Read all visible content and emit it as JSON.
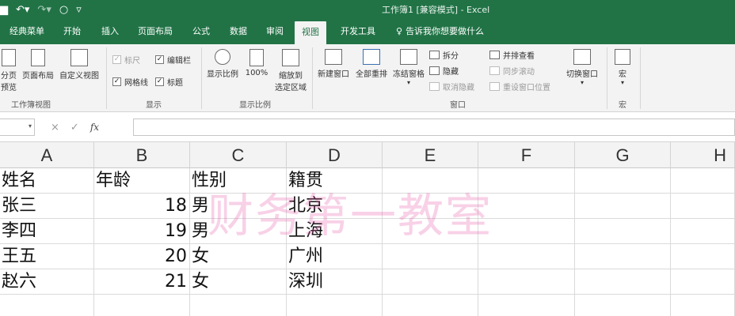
{
  "window": {
    "title": "工作簿1 [兼容模式] - Excel"
  },
  "qat": {
    "save_icon": "save-icon",
    "undo_icon": "undo-icon",
    "redo_icon": "redo-icon",
    "circle_icon": "touch-mode-icon",
    "customize_icon": "qat-customize-icon"
  },
  "tabs": [
    {
      "label": "经典菜单"
    },
    {
      "label": "开始"
    },
    {
      "label": "插入"
    },
    {
      "label": "页面布局"
    },
    {
      "label": "公式"
    },
    {
      "label": "数据"
    },
    {
      "label": "审阅"
    },
    {
      "label": "视图"
    },
    {
      "label": "开发工具"
    }
  ],
  "active_tab": "视图",
  "tell_me": "告诉我你想要做什么",
  "ribbon": {
    "workbook_views": {
      "page_break_line1": "分页",
      "page_break_line2": "预览",
      "page_layout": "页面布局",
      "custom_views": "自定义视图",
      "group_label": "工作簿视图"
    },
    "show": {
      "ruler": "标尺",
      "formula_bar": "编辑栏",
      "gridlines": "网格线",
      "headings": "标题",
      "group_label": "显示"
    },
    "zoom": {
      "zoom": "显示比例",
      "zoom_100": "100%",
      "zoom_selection_line1": "缩放到",
      "zoom_selection_line2": "选定区域",
      "group_label": "显示比例"
    },
    "window": {
      "new_window": "新建窗口",
      "arrange_all": "全部重排",
      "freeze_panes": "冻结窗格",
      "split": "拆分",
      "hide": "隐藏",
      "unhide": "取消隐藏",
      "view_side_by_side": "并排查看",
      "sync_scrolling": "同步滚动",
      "reset_position": "重设窗口位置",
      "switch_windows": "切换窗口",
      "group_label": "窗口"
    },
    "macros": {
      "macros": "宏",
      "group_label": "宏"
    }
  },
  "formula_bar": {
    "name_box": "",
    "cancel": "×",
    "enter": "✓",
    "fx": "fx",
    "content": ""
  },
  "columns": [
    "A",
    "B",
    "C",
    "D",
    "E",
    "F",
    "G",
    "H"
  ],
  "rows": [
    [
      "姓名",
      "年龄",
      "性别",
      "籍贯"
    ],
    [
      "张三",
      "18",
      "男",
      "北京"
    ],
    [
      "李四",
      "19",
      "男",
      "上海"
    ],
    [
      "王五",
      "20",
      "女",
      "广州"
    ],
    [
      "赵六",
      "21",
      "女",
      "深圳"
    ]
  ],
  "watermark": "财务第一教室",
  "colors": {
    "excel_green": "#217346",
    "ribbon_bg": "#f3f3f3",
    "watermark": "#e65aaa"
  }
}
